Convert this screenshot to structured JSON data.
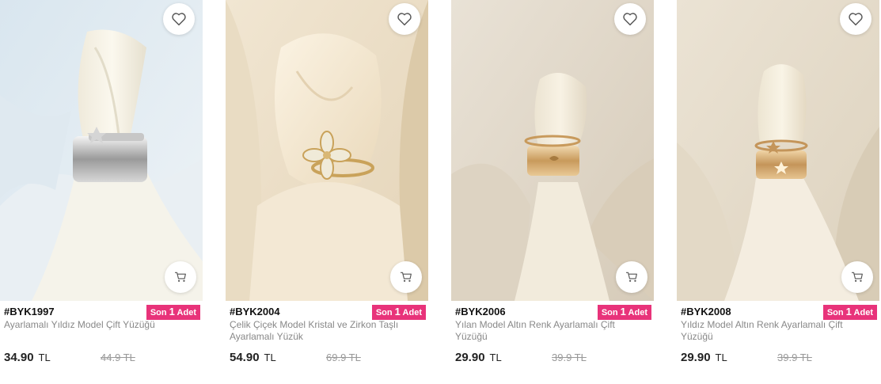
{
  "products": [
    {
      "code": "#BYK1997",
      "stock_prefix": "Son",
      "stock_count": "1",
      "stock_suffix": "Adet",
      "title": "Ayarlamalı Yıldız Model Çift Yüzüğü",
      "price": "34.90",
      "currency": "TL",
      "old_price": "44.9 TL"
    },
    {
      "code": "#BYK2004",
      "stock_prefix": "Son",
      "stock_count": "1",
      "stock_suffix": "Adet",
      "title": "Çelik Çiçek Model Kristal ve Zirkon Taşlı Ayarlamalı Yüzük",
      "price": "54.90",
      "currency": "TL",
      "old_price": "69.9 TL"
    },
    {
      "code": "#BYK2006",
      "stock_prefix": "Son",
      "stock_count": "1",
      "stock_suffix": "Adet",
      "title": "Yılan Model Altın Renk Ayarlamalı Çift Yüzüğü",
      "price": "29.90",
      "currency": "TL",
      "old_price": "39.9 TL"
    },
    {
      "code": "#BYK2008",
      "stock_prefix": "Son",
      "stock_count": "1",
      "stock_suffix": "Adet",
      "title": "Yıldız Model Altın Renk Ayarlamalı Çift Yüzüğü",
      "price": "29.90",
      "currency": "TL",
      "old_price": "39.9 TL"
    }
  ],
  "icons": {
    "favorite": "heart-icon",
    "cart": "cart-icon"
  },
  "colors": {
    "badge": "#e8337a",
    "old_price": "#999999",
    "title": "#888888"
  }
}
